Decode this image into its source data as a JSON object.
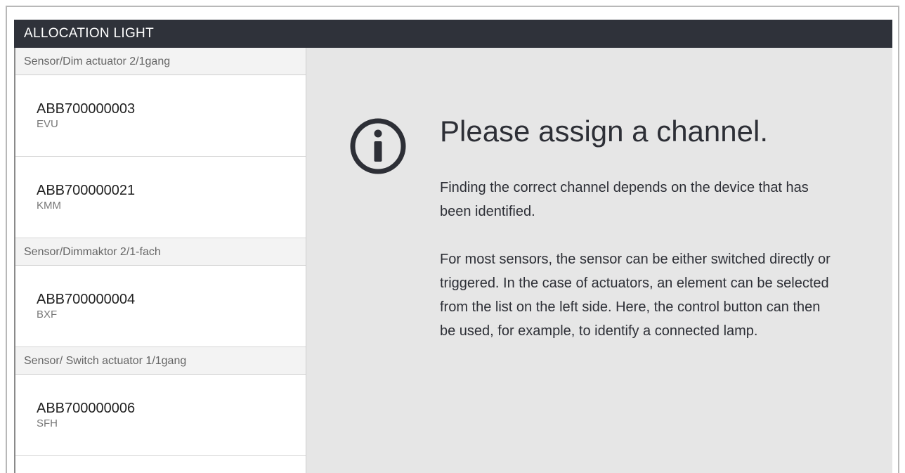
{
  "window": {
    "title": "ALLOCATION LIGHT"
  },
  "sidebar": {
    "groups": [
      {
        "header": "Sensor/Dim actuator 2/1gang",
        "devices": [
          {
            "id": "ABB700000003",
            "sub": "EVU"
          },
          {
            "id": "ABB700000021",
            "sub": "KMM"
          }
        ]
      },
      {
        "header": "Sensor/Dimmaktor 2/1-fach",
        "devices": [
          {
            "id": "ABB700000004",
            "sub": "BXF"
          }
        ]
      },
      {
        "header": "Sensor/ Switch actuator 1/1gang",
        "devices": [
          {
            "id": "ABB700000006",
            "sub": "SFH"
          }
        ]
      }
    ]
  },
  "main": {
    "icon": "info-icon",
    "heading": "Please assign a channel.",
    "paragraphs": [
      "Finding the correct channel depends on the device that has been identified.",
      "For most sensors, the sensor can be either switched directly or triggered. In the case of actuators, an element can be selected from the list on the left side. Here, the control button can then be used, for example, to identify a connected lamp."
    ]
  },
  "colors": {
    "titlebar": "#2f323a",
    "main_bg": "#e6e6e6",
    "text_dark": "#2d2f36"
  }
}
